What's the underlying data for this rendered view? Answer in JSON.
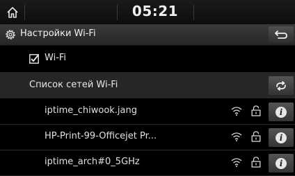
{
  "status_bar": {
    "home_icon": "home-icon",
    "time": "05:21"
  },
  "header": {
    "settings_icon": "gear-icon",
    "title": "Настройки Wi-Fi",
    "back_icon": "back-arrow-icon"
  },
  "wifi_toggle": {
    "label": "Wi-Fi",
    "checked": true
  },
  "network_list": {
    "header": "Список сетей Wi-Fi",
    "refresh_icon": "refresh-icon",
    "items": [
      {
        "ssid": "iptime_chiwook.jang",
        "signal_icon": "wifi-signal-icon",
        "secured_icon": "lock-icon",
        "info_icon": "info-icon"
      },
      {
        "ssid": "HP-Print-99-Officejet Pr...",
        "signal_icon": "wifi-signal-icon",
        "secured_icon": "lock-icon",
        "info_icon": "info-icon"
      },
      {
        "ssid": "iptime_arch#0_5GHz",
        "signal_icon": "wifi-signal-icon",
        "secured_icon": "lock-icon",
        "info_icon": "info-icon"
      }
    ]
  }
}
